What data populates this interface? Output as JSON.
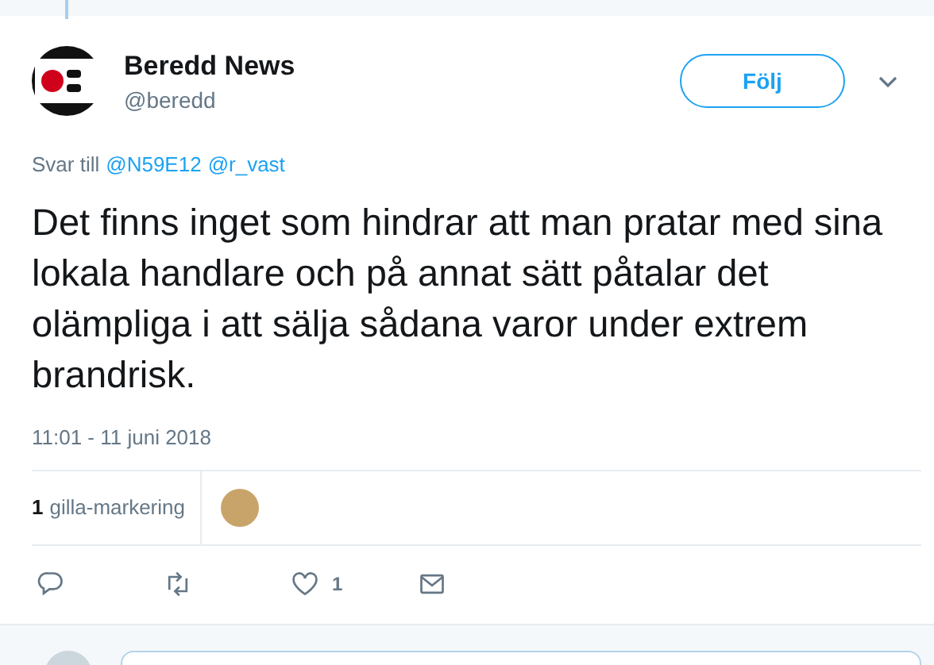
{
  "tweet": {
    "author": {
      "name": "Beredd News",
      "handle": "@beredd"
    },
    "follow_button": "Följ",
    "reply_to": {
      "label": "Svar till",
      "mentions": [
        "@N59E12",
        "@r_vast"
      ]
    },
    "text": "Det finns inget som hindrar att man pratar med sina lokala handlare och på annat sätt påtalar det olämpliga i att sälja sådana varor under extrem brandrisk.",
    "timestamp": "11:01 - 11 juni 2018",
    "likes": {
      "count": "1",
      "label": "gilla-markering"
    },
    "actions": [
      {
        "kind": "reply"
      },
      {
        "kind": "retweet"
      },
      {
        "kind": "like",
        "count": "1"
      },
      {
        "kind": "message"
      }
    ]
  }
}
